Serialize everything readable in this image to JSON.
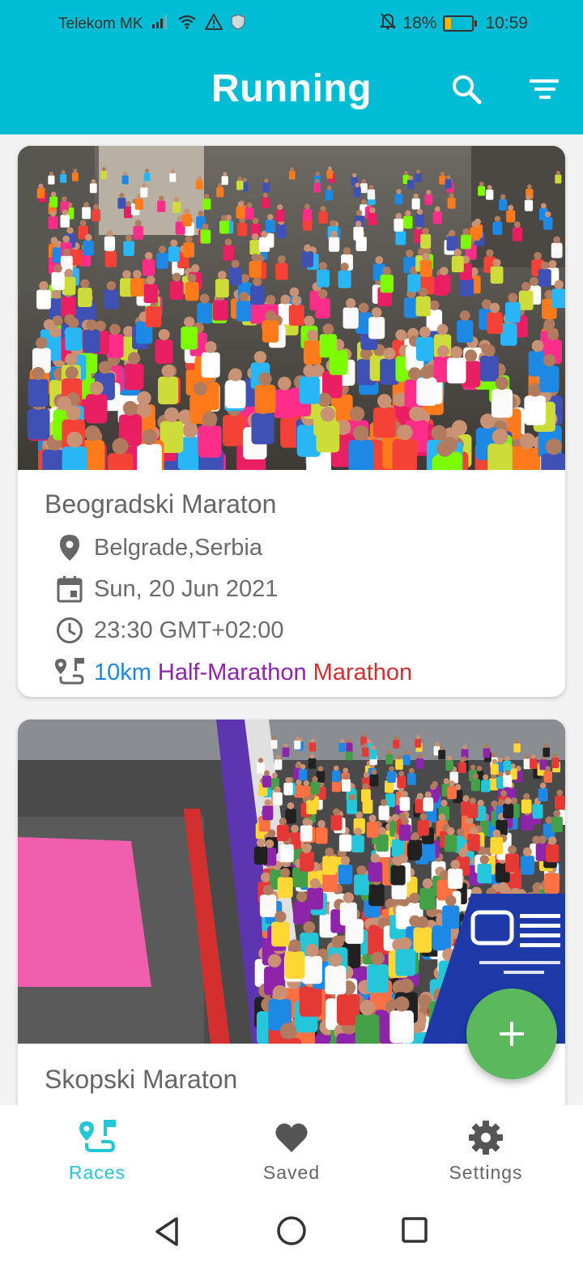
{
  "status_bar": {
    "carrier": "Telekom MK",
    "battery_percent": "18%",
    "battery_level": 0.18,
    "time": "10:59"
  },
  "app_bar": {
    "title": "Running",
    "actions": [
      "search-icon",
      "filter-icon"
    ]
  },
  "races": [
    {
      "title": "Beogradski Maraton",
      "location": "Belgrade,Serbia",
      "date": "Sun, 20 Jun 2021",
      "time": "23:30 GMT+02:00",
      "distances": [
        "10km",
        "Half-Marathon",
        "Marathon"
      ]
    },
    {
      "title": "Skopski Maraton"
    }
  ],
  "colors": {
    "primary": "#00bcd4",
    "fab": "#5cb85c",
    "dist_10km": "#1e88e5",
    "dist_half": "#8e24aa",
    "dist_full": "#d32f2f",
    "nav_active": "#26c6da"
  },
  "bottom_nav": {
    "items": [
      {
        "label": "Races",
        "icon": "races-icon",
        "active": true
      },
      {
        "label": "Saved",
        "icon": "heart-icon",
        "active": false
      },
      {
        "label": "Settings",
        "icon": "gear-icon",
        "active": false
      }
    ]
  },
  "fab": {
    "icon": "plus-icon"
  }
}
